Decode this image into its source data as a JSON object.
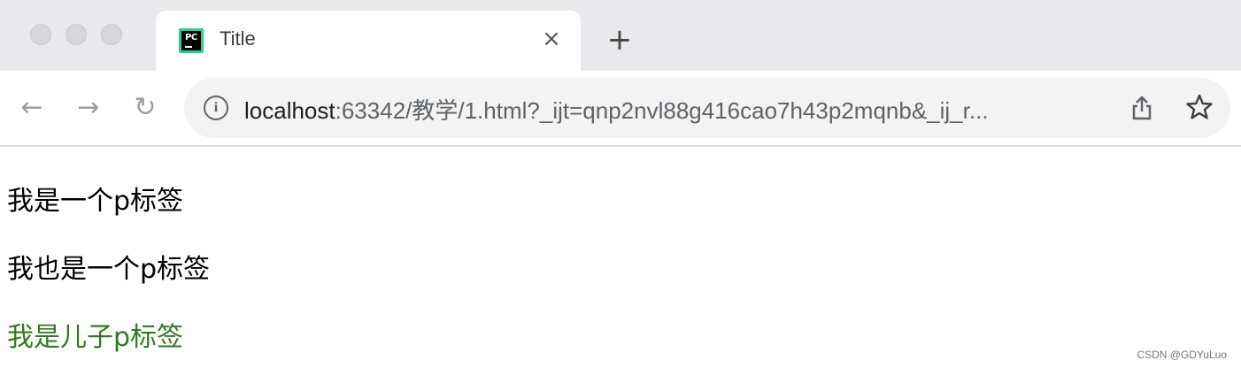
{
  "tab": {
    "title": "Title",
    "favicon": "pycharm-icon",
    "close": "×"
  },
  "new_tab": "+",
  "toolbar": {
    "back": "←",
    "forward": "→",
    "reload": "↻",
    "url_host": "localhost",
    "url_rest": ":63342/教学/1.html?_ijt=qnp2nvl88g416cao7h43p2mqnb&_ij_r..."
  },
  "content": {
    "paragraphs": [
      "我是一个p标签",
      "我也是一个p标签",
      "我是儿子p标签"
    ],
    "child_color": "#2e7d1f"
  },
  "watermark": "CSDN @GDYuLuo"
}
